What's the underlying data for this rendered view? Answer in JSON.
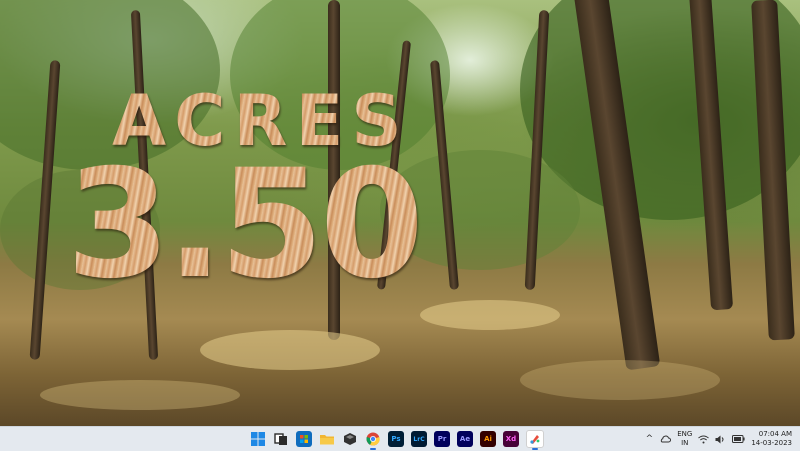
{
  "wallpaper": {
    "line1": "ACRES",
    "line2": "3.50"
  },
  "taskbar": {
    "apps": [
      {
        "name": "start",
        "icon": "windows-logo-icon",
        "label": "",
        "color": "#1e88e5"
      },
      {
        "name": "task-view",
        "icon": "task-view-icon",
        "label": "",
        "color": "#2b2b2b"
      },
      {
        "name": "store",
        "icon": "store-icon",
        "label": "",
        "color": "#0f6cbd"
      },
      {
        "name": "file-explorer",
        "icon": "folder-icon",
        "label": "",
        "color": "#f2b632"
      },
      {
        "name": "unity",
        "icon": "cube-icon",
        "label": "",
        "color": "#333333"
      },
      {
        "name": "chrome",
        "icon": "chrome-icon",
        "label": "",
        "color": "#db4437"
      },
      {
        "name": "photoshop",
        "icon": "photoshop-icon",
        "label": "Ps",
        "color": "#001e36"
      },
      {
        "name": "lightroom-classic",
        "icon": "lightroom-icon",
        "label": "LrC",
        "color": "#001a33"
      },
      {
        "name": "premiere",
        "icon": "premiere-icon",
        "label": "Pr",
        "color": "#00005b"
      },
      {
        "name": "after-effects",
        "icon": "after-effects-icon",
        "label": "Ae",
        "color": "#00005b"
      },
      {
        "name": "illustrator",
        "icon": "illustrator-icon",
        "label": "Ai",
        "color": "#330000"
      },
      {
        "name": "xd",
        "icon": "xd-icon",
        "label": "Xd",
        "color": "#470137"
      },
      {
        "name": "paint-app",
        "icon": "paint-icon",
        "label": "",
        "color": "#ffffff"
      }
    ],
    "tray": {
      "chevron": "^",
      "language_line1": "ENG",
      "language_line2": "IN",
      "time": "07:04 AM",
      "date": "14-03-2023"
    }
  }
}
